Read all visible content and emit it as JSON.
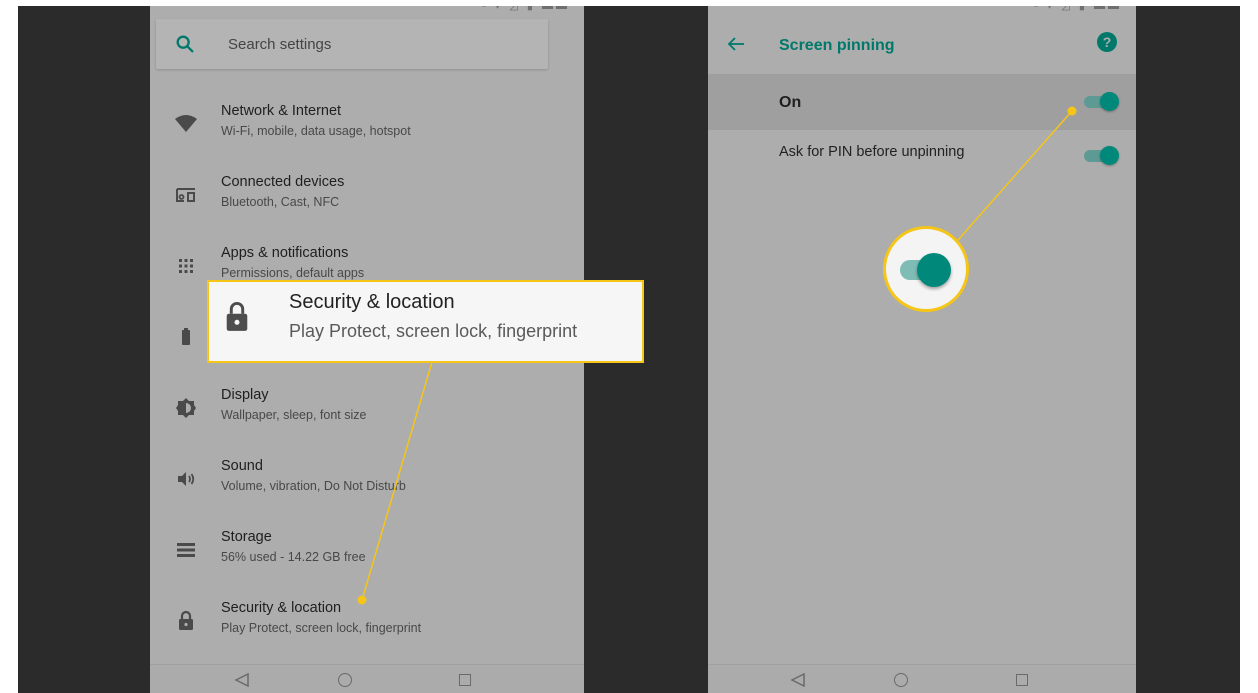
{
  "colors": {
    "accent": "#00796b",
    "highlight": "#f5c518",
    "screen_bg": "#adadad",
    "frame_bg": "#2b2b2b"
  },
  "left_screen": {
    "search": {
      "placeholder": "Search settings"
    },
    "items": [
      {
        "title": "Network & Internet",
        "subtitle": "Wi-Fi, mobile, data usage, hotspot",
        "icon": "wifi-icon"
      },
      {
        "title": "Connected devices",
        "subtitle": "Bluetooth, Cast, NFC",
        "icon": "devices-icon"
      },
      {
        "title": "Apps & notifications",
        "subtitle": "Permissions, default apps",
        "icon": "apps-grid-icon"
      },
      {
        "title": "Battery",
        "subtitle": "",
        "icon": "battery-icon"
      },
      {
        "title": "Display",
        "subtitle": "Wallpaper, sleep, font size",
        "icon": "brightness-icon"
      },
      {
        "title": "Sound",
        "subtitle": "Volume, vibration, Do Not Disturb",
        "icon": "volume-icon"
      },
      {
        "title": "Storage",
        "subtitle": "56% used - 14.22 GB free",
        "icon": "storage-icon"
      },
      {
        "title": "Security & location",
        "subtitle": "Play Protect, screen lock, fingerprint",
        "icon": "lock-icon"
      }
    ],
    "callout": {
      "title": "Security & location",
      "subtitle": "Play Protect, screen lock, fingerprint"
    }
  },
  "right_screen": {
    "title": "Screen pinning",
    "help": "?",
    "main_toggle": {
      "label": "On",
      "state": true
    },
    "pin_toggle": {
      "label": "Ask for PIN before unpinning",
      "state": true
    }
  }
}
